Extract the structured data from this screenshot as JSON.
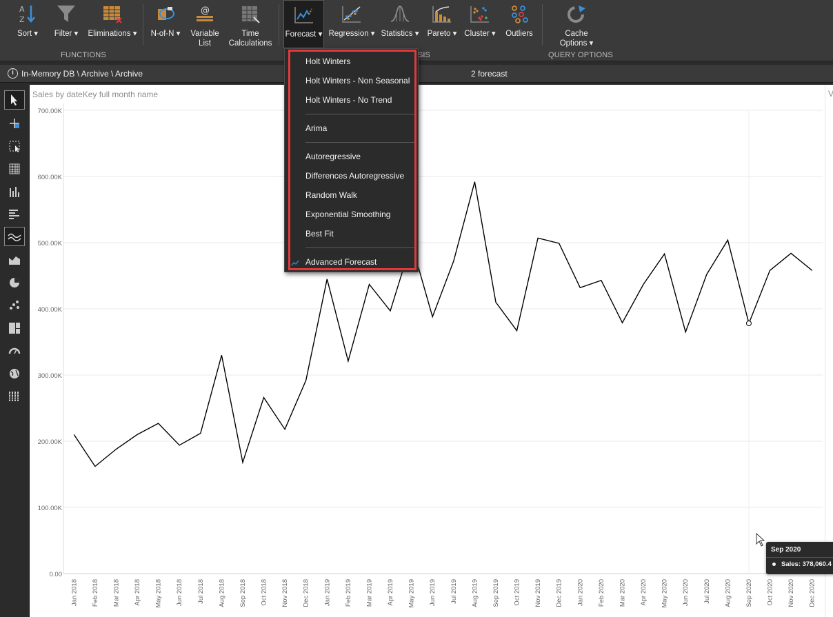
{
  "ribbon": {
    "buttons": [
      {
        "label": "Sort ▾",
        "icon": "sort-az-icon"
      },
      {
        "label": "Filter ▾",
        "icon": "filter-funnel-icon"
      },
      {
        "label": "Eliminations ▾",
        "icon": "eliminations-table-icon"
      },
      {
        "label": "N-of-N ▾",
        "icon": "n-of-n-icon"
      },
      {
        "label": "Variable\nList",
        "icon": "variable-list-icon"
      },
      {
        "label": "Time\nCalculations",
        "icon": "time-calculations-icon"
      },
      {
        "label": "Forecast ▾",
        "icon": "forecast-line-icon"
      },
      {
        "label": "Regression ▾",
        "icon": "regression-scatter-icon"
      },
      {
        "label": "Statistics ▾",
        "icon": "statistics-bell-icon"
      },
      {
        "label": "Pareto ▾",
        "icon": "pareto-chart-icon"
      },
      {
        "label": "Cluster ▾",
        "icon": "cluster-dots-icon"
      },
      {
        "label": "Outliers",
        "icon": "outliers-circles-icon"
      },
      {
        "label": "Cache\nOptions ▾",
        "icon": "cache-refresh-icon"
      }
    ],
    "groups": {
      "functions": "FUNCTIONS",
      "analysis_clipped": "SIS",
      "query_options": "QUERY OPTIONS"
    }
  },
  "pathbar": {
    "path": "In-Memory DB \\ Archive \\ Archive",
    "title": "2 forecast"
  },
  "left_toolbar": [
    "select-pointer-icon",
    "crosshair-add-icon",
    "marquee-select-icon",
    "grid-table-icon",
    "column-chart-icon",
    "bar-chart-icon",
    "line-chart-icon",
    "area-chart-icon",
    "pie-chart-icon",
    "scatter-chart-icon",
    "treemap-icon",
    "gauge-icon",
    "globe-map-icon",
    "pivot-table-icon"
  ],
  "forecast_menu": {
    "items": [
      "Holt Winters",
      "Holt Winters - Non Seasonal",
      "Holt Winters - No Trend",
      "Arima",
      "Autoregressive",
      "Differences Autoregressive",
      "Random Walk",
      "Exponential Smoothing",
      "Best Fit",
      "Advanced Forecast"
    ]
  },
  "tooltip": {
    "title": "Sep 2020",
    "value": "Sales:  378,060.4"
  },
  "right_strip_char": "V",
  "colors": {
    "ribbon_bg": "#3a3a3a",
    "menu_highlight": "#e03a3e",
    "line": "#000000"
  },
  "chart_data": {
    "type": "line",
    "title": "Sales by dateKey full month name",
    "xlabel": "",
    "ylabel": "",
    "ylim": [
      0,
      700000
    ],
    "yticks": [
      "0.00",
      "100.00K",
      "200.00K",
      "300.00K",
      "400.00K",
      "500.00K",
      "600.00K",
      "700.00K"
    ],
    "grid": true,
    "categories": [
      "Jan 2018",
      "Feb 2018",
      "Mar 2018",
      "Apr 2018",
      "May 2018",
      "Jun 2018",
      "Jul 2018",
      "Aug 2018",
      "Sep 2018",
      "Oct 2018",
      "Nov 2018",
      "Dec 2018",
      "Jan 2019",
      "Feb 2019",
      "Mar 2019",
      "Apr 2019",
      "May 2019",
      "Jun 2019",
      "Jul 2019",
      "Aug 2019",
      "Sep 2019",
      "Oct 2019",
      "Nov 2019",
      "Dec 2019",
      "Jan 2020",
      "Feb 2020",
      "Mar 2020",
      "Apr 2020",
      "May 2020",
      "Jun 2020",
      "Jul 2020",
      "Aug 2020",
      "Sep 2020",
      "Oct 2020",
      "Nov 2020",
      "Dec 2020"
    ],
    "series": [
      {
        "values": [
          210000,
          162000,
          188000,
          210000,
          227000,
          194000,
          212000,
          330000,
          168000,
          266000,
          218000,
          292000,
          445000,
          321000,
          437000,
          397000,
          500000,
          388000,
          472000,
          592000,
          410000,
          367000,
          507000,
          499000,
          432000,
          443000,
          379000,
          437000,
          483000,
          365000,
          452000,
          504000,
          378060,
          458000,
          484000,
          458000
        ]
      }
    ],
    "highlight_index": 32
  }
}
